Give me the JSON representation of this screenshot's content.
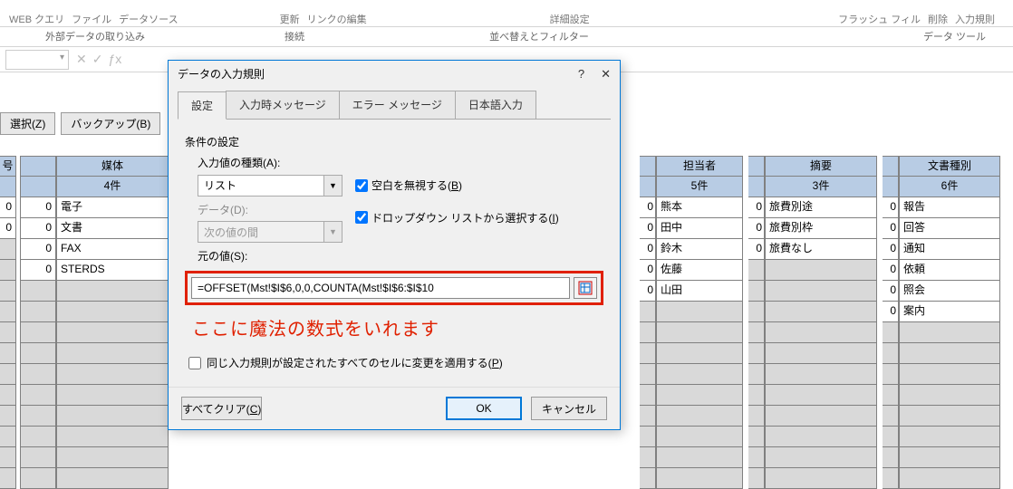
{
  "ribbon": {
    "top_labels": [
      "WEB クエリ",
      "ファイル",
      "データソース",
      "",
      "",
      "更新",
      "リンクの編集",
      "",
      "",
      "",
      "詳細設定",
      "",
      "フラッシュ フィル",
      "削除",
      "入力規則"
    ],
    "sections": {
      "s1": "外部データの取り込み",
      "s2": "接続",
      "s3": "並べ替えとフィルター",
      "s4": "データ ツール"
    }
  },
  "mini_toolbar": {
    "select": "選択(Z)",
    "backup": "バックアップ(B)"
  },
  "dialog": {
    "title": "データの入力規則",
    "help": "?",
    "close": "✕",
    "tabs": {
      "settings": "設定",
      "ime": "入力時メッセージ",
      "error": "エラー メッセージ",
      "jp": "日本語入力"
    },
    "section_title": "条件の設定",
    "allow_label": "入力値の種類(A):",
    "allow_value": "リスト",
    "ignore_blank_prefix": "空白を無視する(",
    "ignore_blank_accel": "B",
    "ignore_blank_suffix": ")",
    "data_label": "データ(D):",
    "data_value": "次の値の間",
    "dropdown_prefix": "ドロップダウン リストから選択する(",
    "dropdown_accel": "I",
    "dropdown_suffix": ")",
    "source_label": "元の値(S):",
    "source_value": "=OFFSET(Mst!$I$6,0,0,COUNTA(Mst!$I$6:$I$10",
    "annotation": "ここに魔法の数式をいれます",
    "apply_all_prefix": "同じ入力規則が設定されたすべてのセルに変更を適用する(",
    "apply_all_accel": "P",
    "apply_all_suffix": ")",
    "clear_prefix": "すべてクリア(",
    "clear_accel": "C",
    "clear_suffix": ")",
    "ok": "OK",
    "cancel": "キャンセル"
  },
  "columns": {
    "id_header": "号",
    "c1": {
      "header": "媒体",
      "sub": "4件",
      "values": [
        "電子",
        "文書",
        "FAX",
        "STERDS",
        "",
        "",
        "",
        "",
        "",
        "",
        "",
        "",
        "",
        ""
      ]
    },
    "c2": {
      "header": "担当者",
      "sub": "5件",
      "values": [
        "熊本",
        "田中",
        "鈴木",
        "佐藤",
        "山田",
        "",
        "",
        "",
        "",
        "",
        "",
        "",
        "",
        ""
      ]
    },
    "c3": {
      "header": "摘要",
      "sub": "3件",
      "values": [
        "旅費別途",
        "旅費別枠",
        "旅費なし",
        "",
        "",
        "",
        "",
        "",
        "",
        "",
        "",
        "",
        "",
        ""
      ]
    },
    "c4": {
      "header": "文書種別",
      "sub": "6件",
      "values": [
        "報告",
        "回答",
        "通知",
        "依頼",
        "照会",
        "案内",
        "",
        "",
        "",
        "",
        "",
        "",
        "",
        ""
      ]
    }
  },
  "zero": "0"
}
